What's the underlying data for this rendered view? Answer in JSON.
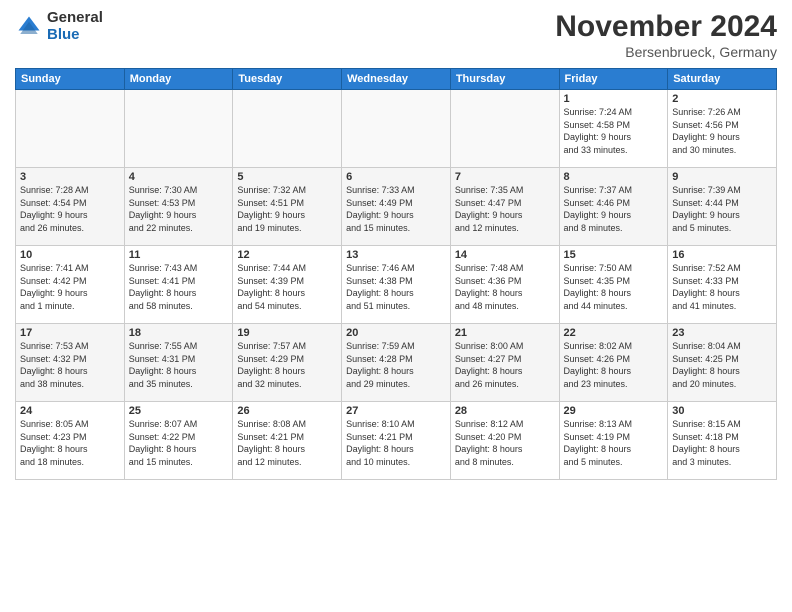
{
  "logo": {
    "general": "General",
    "blue": "Blue"
  },
  "title": "November 2024",
  "location": "Bersenbrueck, Germany",
  "days_header": [
    "Sunday",
    "Monday",
    "Tuesday",
    "Wednesday",
    "Thursday",
    "Friday",
    "Saturday"
  ],
  "weeks": [
    [
      {
        "day": "",
        "info": ""
      },
      {
        "day": "",
        "info": ""
      },
      {
        "day": "",
        "info": ""
      },
      {
        "day": "",
        "info": ""
      },
      {
        "day": "",
        "info": ""
      },
      {
        "day": "1",
        "info": "Sunrise: 7:24 AM\nSunset: 4:58 PM\nDaylight: 9 hours\nand 33 minutes."
      },
      {
        "day": "2",
        "info": "Sunrise: 7:26 AM\nSunset: 4:56 PM\nDaylight: 9 hours\nand 30 minutes."
      }
    ],
    [
      {
        "day": "3",
        "info": "Sunrise: 7:28 AM\nSunset: 4:54 PM\nDaylight: 9 hours\nand 26 minutes."
      },
      {
        "day": "4",
        "info": "Sunrise: 7:30 AM\nSunset: 4:53 PM\nDaylight: 9 hours\nand 22 minutes."
      },
      {
        "day": "5",
        "info": "Sunrise: 7:32 AM\nSunset: 4:51 PM\nDaylight: 9 hours\nand 19 minutes."
      },
      {
        "day": "6",
        "info": "Sunrise: 7:33 AM\nSunset: 4:49 PM\nDaylight: 9 hours\nand 15 minutes."
      },
      {
        "day": "7",
        "info": "Sunrise: 7:35 AM\nSunset: 4:47 PM\nDaylight: 9 hours\nand 12 minutes."
      },
      {
        "day": "8",
        "info": "Sunrise: 7:37 AM\nSunset: 4:46 PM\nDaylight: 9 hours\nand 8 minutes."
      },
      {
        "day": "9",
        "info": "Sunrise: 7:39 AM\nSunset: 4:44 PM\nDaylight: 9 hours\nand 5 minutes."
      }
    ],
    [
      {
        "day": "10",
        "info": "Sunrise: 7:41 AM\nSunset: 4:42 PM\nDaylight: 9 hours\nand 1 minute."
      },
      {
        "day": "11",
        "info": "Sunrise: 7:43 AM\nSunset: 4:41 PM\nDaylight: 8 hours\nand 58 minutes."
      },
      {
        "day": "12",
        "info": "Sunrise: 7:44 AM\nSunset: 4:39 PM\nDaylight: 8 hours\nand 54 minutes."
      },
      {
        "day": "13",
        "info": "Sunrise: 7:46 AM\nSunset: 4:38 PM\nDaylight: 8 hours\nand 51 minutes."
      },
      {
        "day": "14",
        "info": "Sunrise: 7:48 AM\nSunset: 4:36 PM\nDaylight: 8 hours\nand 48 minutes."
      },
      {
        "day": "15",
        "info": "Sunrise: 7:50 AM\nSunset: 4:35 PM\nDaylight: 8 hours\nand 44 minutes."
      },
      {
        "day": "16",
        "info": "Sunrise: 7:52 AM\nSunset: 4:33 PM\nDaylight: 8 hours\nand 41 minutes."
      }
    ],
    [
      {
        "day": "17",
        "info": "Sunrise: 7:53 AM\nSunset: 4:32 PM\nDaylight: 8 hours\nand 38 minutes."
      },
      {
        "day": "18",
        "info": "Sunrise: 7:55 AM\nSunset: 4:31 PM\nDaylight: 8 hours\nand 35 minutes."
      },
      {
        "day": "19",
        "info": "Sunrise: 7:57 AM\nSunset: 4:29 PM\nDaylight: 8 hours\nand 32 minutes."
      },
      {
        "day": "20",
        "info": "Sunrise: 7:59 AM\nSunset: 4:28 PM\nDaylight: 8 hours\nand 29 minutes."
      },
      {
        "day": "21",
        "info": "Sunrise: 8:00 AM\nSunset: 4:27 PM\nDaylight: 8 hours\nand 26 minutes."
      },
      {
        "day": "22",
        "info": "Sunrise: 8:02 AM\nSunset: 4:26 PM\nDaylight: 8 hours\nand 23 minutes."
      },
      {
        "day": "23",
        "info": "Sunrise: 8:04 AM\nSunset: 4:25 PM\nDaylight: 8 hours\nand 20 minutes."
      }
    ],
    [
      {
        "day": "24",
        "info": "Sunrise: 8:05 AM\nSunset: 4:23 PM\nDaylight: 8 hours\nand 18 minutes."
      },
      {
        "day": "25",
        "info": "Sunrise: 8:07 AM\nSunset: 4:22 PM\nDaylight: 8 hours\nand 15 minutes."
      },
      {
        "day": "26",
        "info": "Sunrise: 8:08 AM\nSunset: 4:21 PM\nDaylight: 8 hours\nand 12 minutes."
      },
      {
        "day": "27",
        "info": "Sunrise: 8:10 AM\nSunset: 4:21 PM\nDaylight: 8 hours\nand 10 minutes."
      },
      {
        "day": "28",
        "info": "Sunrise: 8:12 AM\nSunset: 4:20 PM\nDaylight: 8 hours\nand 8 minutes."
      },
      {
        "day": "29",
        "info": "Sunrise: 8:13 AM\nSunset: 4:19 PM\nDaylight: 8 hours\nand 5 minutes."
      },
      {
        "day": "30",
        "info": "Sunrise: 8:15 AM\nSunset: 4:18 PM\nDaylight: 8 hours\nand 3 minutes."
      }
    ]
  ]
}
